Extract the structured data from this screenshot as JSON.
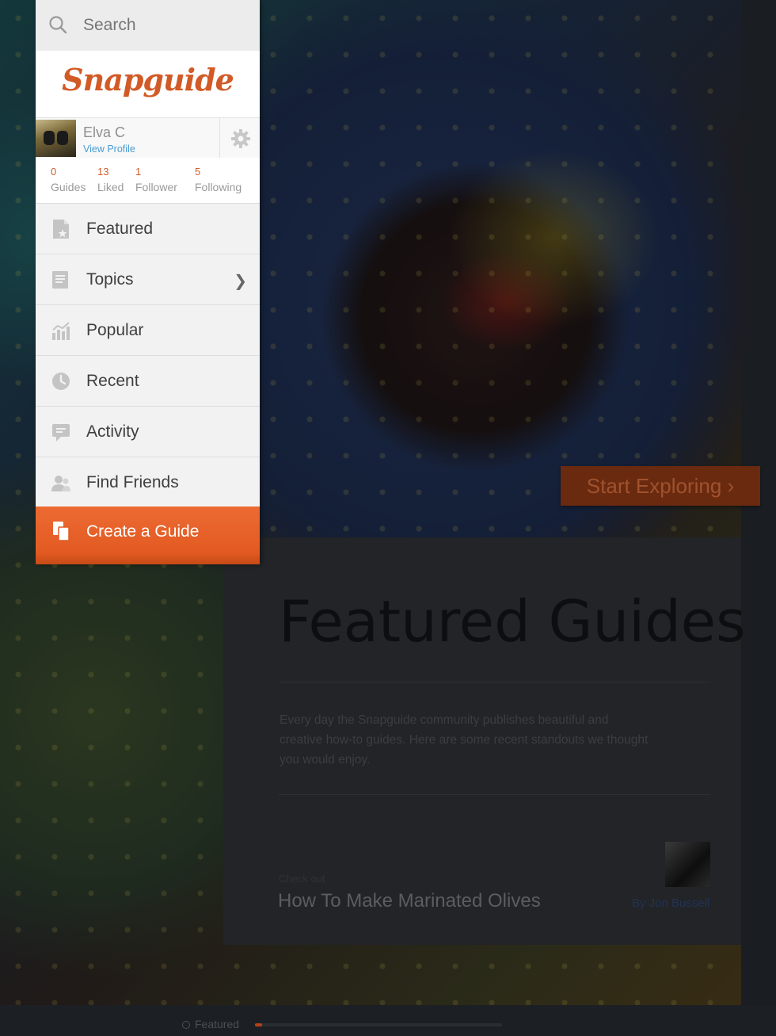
{
  "sidebar": {
    "search": {
      "placeholder": "Search"
    },
    "logo": "Snapguide",
    "profile": {
      "name": "Elva C",
      "link": "View Profile"
    },
    "stats": [
      {
        "value": "0",
        "label": "Guides"
      },
      {
        "value": "13",
        "label": "Liked"
      },
      {
        "value": "1",
        "label": "Follower"
      },
      {
        "value": "5",
        "label": "Following"
      }
    ],
    "menu": [
      {
        "label": "Featured",
        "icon": "featured-document-icon"
      },
      {
        "label": "Topics",
        "icon": "topics-book-icon"
      },
      {
        "label": "Popular",
        "icon": "popular-chart-icon"
      },
      {
        "label": "Recent",
        "icon": "recent-clock-icon"
      },
      {
        "label": "Activity",
        "icon": "activity-chat-icon"
      },
      {
        "label": "Find Friends",
        "icon": "find-friends-icon"
      }
    ],
    "create": {
      "label": "Create a Guide",
      "icon": "create-guide-icon"
    }
  },
  "hero": {
    "cta": "Start Exploring ›"
  },
  "featured": {
    "title": "Featured Guides",
    "description": "Every day the Snapguide community publishes beautiful and creative how-to guides. Here are some recent standouts we thought you would enjoy.",
    "checkout_label": "Check out",
    "guide_title": "How To Make Marinated Olives",
    "author": "By Jon Bussell"
  },
  "bottom": {
    "label": "Featured",
    "progress": 0.03
  },
  "colors": {
    "accent": "#e25a22",
    "link": "#4a9bd1"
  }
}
